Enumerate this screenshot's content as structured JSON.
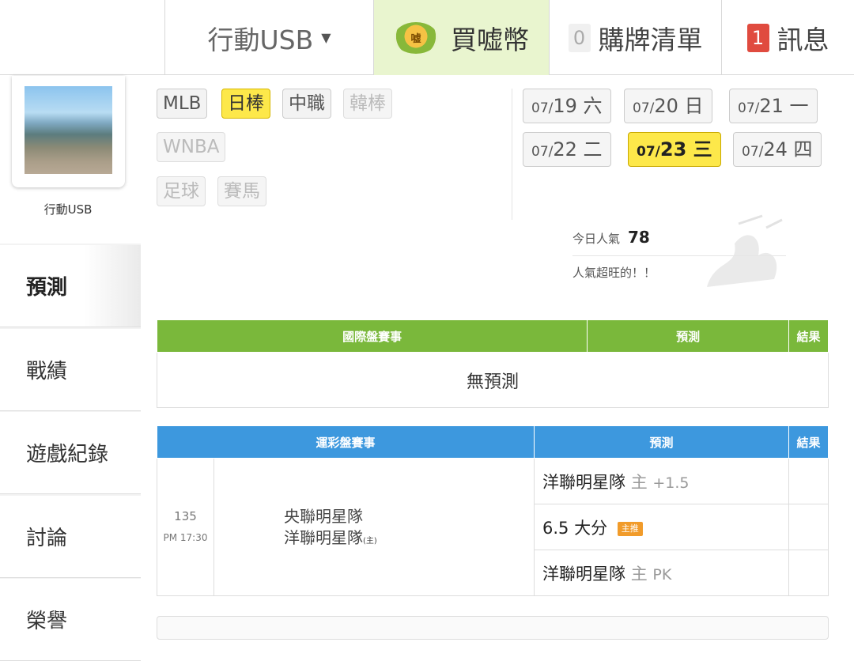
{
  "header": {
    "user_label": "行動USB",
    "buy_label": "買嘘幣",
    "coin_text": "嘘",
    "cart_count": "0",
    "cart_label": "購牌清單",
    "msg_count": "1",
    "msg_label": "訊息"
  },
  "sidebar": {
    "profile_name": "行動USB",
    "items": [
      {
        "label": "預測"
      },
      {
        "label": "戰績"
      },
      {
        "label": "遊戲紀錄"
      },
      {
        "label": "討論"
      },
      {
        "label": "榮譽"
      }
    ]
  },
  "leagues": [
    {
      "label": "MLB",
      "state": "normal"
    },
    {
      "label": "日棒",
      "state": "selected"
    },
    {
      "label": "中職",
      "state": "normal"
    },
    {
      "label": "韓棒",
      "state": "disabled"
    },
    {
      "label": "WNBA",
      "state": "disabled"
    },
    {
      "label": "足球",
      "state": "disabled"
    },
    {
      "label": "賽馬",
      "state": "disabled"
    }
  ],
  "dates": [
    {
      "month": "07/",
      "day": "19",
      "weekday": "六"
    },
    {
      "month": "07/",
      "day": "20",
      "weekday": "日"
    },
    {
      "month": "07/",
      "day": "21",
      "weekday": "一"
    },
    {
      "month": "07/",
      "day": "22",
      "weekday": "二"
    },
    {
      "month": "07/",
      "day": "23",
      "weekday": "三",
      "selected": true
    },
    {
      "month": "07/",
      "day": "24",
      "weekday": "四"
    }
  ],
  "popularity": {
    "label": "今日人氣",
    "value": "78",
    "note": "人氣超旺的！！"
  },
  "intl_table": {
    "headers": [
      "國際盤賽事",
      "預測",
      "結果"
    ],
    "empty_text": "無預測"
  },
  "sport_table": {
    "headers": [
      "運彩盤賽事",
      "預測",
      "結果"
    ],
    "game": {
      "number": "135",
      "time": "PM 17:30",
      "away": "央聯明星隊",
      "home": "洋聯明星隊",
      "home_mark": "(主)"
    },
    "picks": [
      {
        "team": "洋聯明星隊",
        "side": "主",
        "line": "+1.5"
      },
      {
        "team": "6.5 大分",
        "badge": "主推"
      },
      {
        "team": "洋聯明星隊",
        "side": "主",
        "line": "PK"
      }
    ]
  }
}
